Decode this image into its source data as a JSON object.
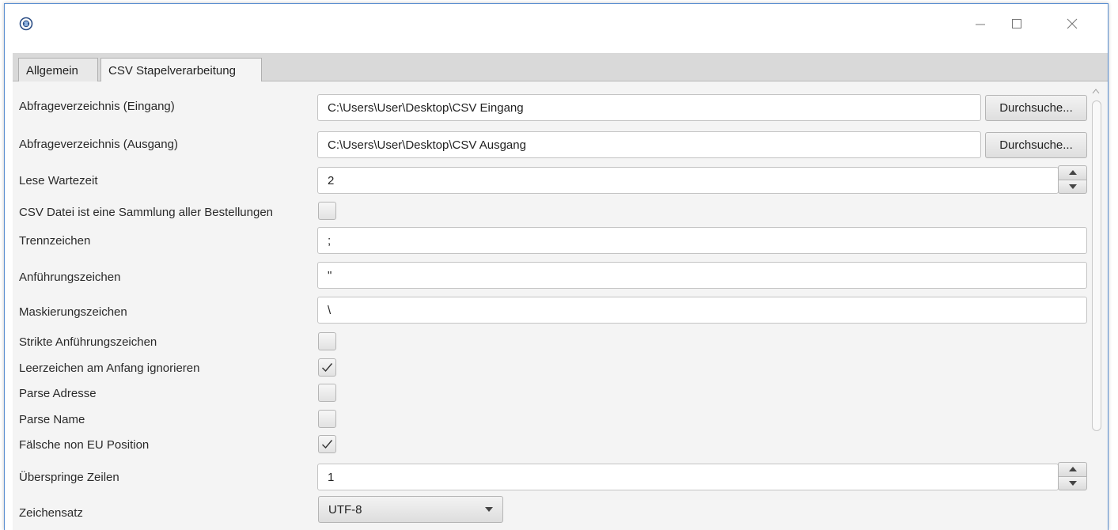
{
  "window": {
    "app_icon": "globe-icon",
    "controls": {
      "minimize": "minimize-icon",
      "maximize": "maximize-icon",
      "close": "close-icon"
    }
  },
  "tabs": [
    {
      "label": "Allgemein",
      "active": false
    },
    {
      "label": "CSV Stapelverarbeitung",
      "active": true
    }
  ],
  "form": {
    "input_dir": {
      "label": "Abfrageverzeichnis (Eingang)",
      "value": "C:\\Users\\User\\Desktop\\CSV Eingang",
      "button": "Durchsuche..."
    },
    "output_dir": {
      "label": "Abfrageverzeichnis (Ausgang)",
      "value": "C:\\Users\\User\\Desktop\\CSV Ausgang",
      "button": "Durchsuche..."
    },
    "read_wait": {
      "label": "Lese Wartezeit",
      "value": "2"
    },
    "collection": {
      "label": "CSV Datei ist eine Sammlung aller Bestellungen",
      "checked": false
    },
    "separator": {
      "label": "Trennzeichen",
      "value": ";"
    },
    "quote": {
      "label": "Anführungszeichen",
      "value": "\""
    },
    "escape": {
      "label": "Maskierungszeichen",
      "value": "\\"
    },
    "strict_quotes": {
      "label": "Strikte Anführungszeichen",
      "checked": false
    },
    "ignore_leading": {
      "label": "Leerzeichen am Anfang ignorieren",
      "checked": true
    },
    "parse_address": {
      "label": "Parse Adresse",
      "checked": false
    },
    "parse_name": {
      "label": "Parse Name",
      "checked": false
    },
    "fake_non_eu": {
      "label": "Fälsche non EU Position",
      "checked": true
    },
    "skip_lines": {
      "label": "Überspringe Zeilen",
      "value": "1"
    },
    "charset": {
      "label": "Zeichensatz",
      "value": "UTF-8"
    }
  },
  "colors": {
    "window_border": "#5b8fd1",
    "panel_bg": "#f4f4f4",
    "tabbar_bg": "#d9d9d9"
  }
}
